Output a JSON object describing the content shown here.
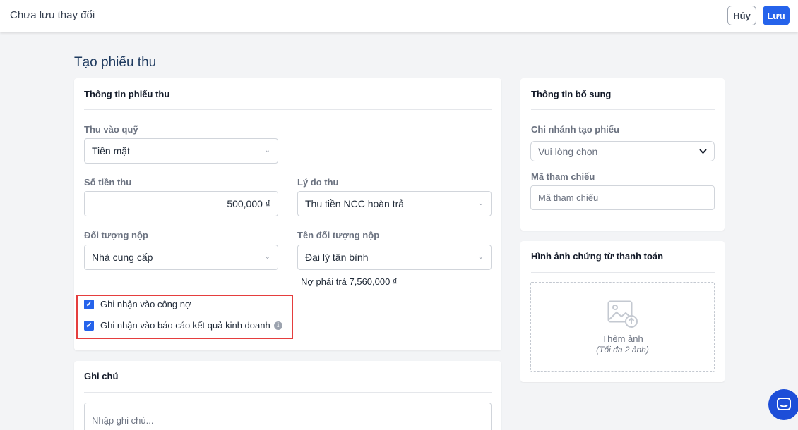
{
  "header": {
    "title": "Chưa lưu thay đổi",
    "cancel_label": "Hủy",
    "save_label": "Lưu"
  },
  "page": {
    "title": "Tạo phiếu thu"
  },
  "receipt_info": {
    "title": "Thông tin phiếu thu",
    "fund_label": "Thu vào quỹ",
    "fund_value": "Tiền mặt",
    "amount_label": "Số tiền thu",
    "amount_value": "500,000 ₫",
    "reason_label": "Lý do thu",
    "reason_value": "Thu tiền NCC hoàn trả",
    "payer_type_label": "Đối tượng nộp",
    "payer_type_value": "Nhà cung cấp",
    "payer_name_label": "Tên đối tượng nộp",
    "payer_name_value": "Đại lý tân bình",
    "debt_note": "Nợ phải trả 7,560,000 ₫",
    "checkbox_debt_label": "Ghi nhận vào công nợ",
    "checkbox_debt_checked": true,
    "checkbox_report_label": "Ghi nhận vào báo cáo kết quả kinh doanh",
    "checkbox_report_checked": true
  },
  "notes": {
    "title": "Ghi chú",
    "placeholder": "Nhập ghi chú..."
  },
  "additional_info": {
    "title": "Thông tin bổ sung",
    "branch_label": "Chi nhánh tạo phiếu",
    "branch_placeholder": "Vui lòng chọn",
    "reference_label": "Mã tham chiếu",
    "reference_placeholder": "Mã tham chiếu"
  },
  "payment_images": {
    "title": "Hình ảnh chứng từ thanh toán",
    "add_label": "Thêm ảnh",
    "limit_note": "(Tối đa 2 ảnh)"
  },
  "icons": {
    "chevron": "chevron-down-icon",
    "checkbox": "checkbox-checked-icon",
    "info": "info-icon",
    "image_upload": "image-upload-icon",
    "chat": "chat-icon"
  },
  "colors": {
    "primary": "#2563eb",
    "highlight_border": "#e53e3e"
  }
}
